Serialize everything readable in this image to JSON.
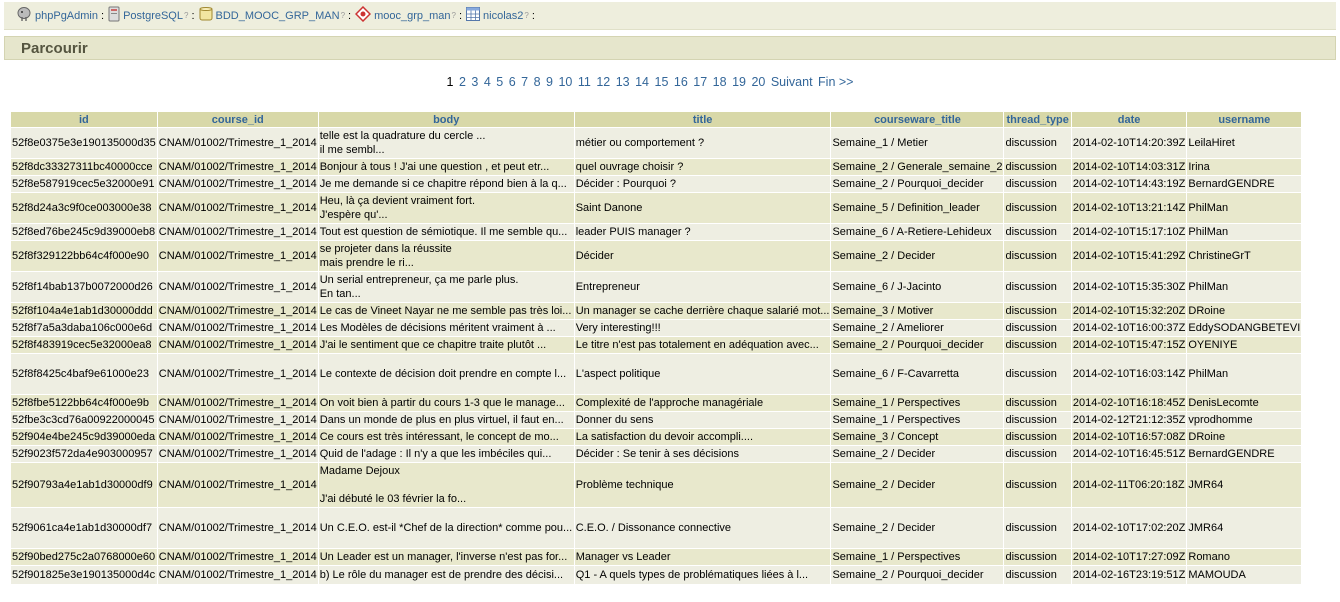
{
  "breadcrumb": {
    "server": "phpPgAdmin",
    "database_server": "PostgreSQL",
    "database": "BDD_MOOC_GRP_MAN",
    "schema": "mooc_grp_man",
    "table": "nicolas2",
    "help_mark": "?",
    "separator": ":"
  },
  "page_title": "Parcourir",
  "pager": {
    "current": "1",
    "pages": [
      "2",
      "3",
      "4",
      "5",
      "6",
      "7",
      "8",
      "9",
      "10",
      "11",
      "12",
      "13",
      "14",
      "15",
      "16",
      "17",
      "18",
      "19",
      "20"
    ],
    "next_label": "Suivant",
    "last_label": "Fin >>"
  },
  "table": {
    "columns": [
      "id",
      "course_id",
      "body",
      "title",
      "courseware_title",
      "thread_type",
      "date",
      "username"
    ],
    "rows": [
      {
        "id": "52f8e0375e3e190135000d35",
        "course_id": "CNAM/01002/Trimestre_1_2014",
        "body": "telle est la quadrature du cercle ...\nil me sembl...",
        "title": "métier ou comportement ?",
        "courseware_title": "Semaine_1 / Metier",
        "thread_type": "discussion",
        "date": "2014-02-10T14:20:39Z",
        "username": "LeilaHiret"
      },
      {
        "id": "52f8dc33327311bc40000cce",
        "course_id": "CNAM/01002/Trimestre_1_2014",
        "body": "Bonjour à tous ! J'ai une question , et peut etr...",
        "title": "quel ouvrage choisir ?",
        "courseware_title": "Semaine_2 / Generale_semaine_2",
        "thread_type": "discussion",
        "date": "2014-02-10T14:03:31Z",
        "username": "Irina"
      },
      {
        "id": "52f8e587919cec5e32000e91",
        "course_id": "CNAM/01002/Trimestre_1_2014",
        "body": "Je me demande si ce chapitre répond bien à la q...",
        "title": "Décider : Pourquoi ?",
        "courseware_title": "Semaine_2 / Pourquoi_decider",
        "thread_type": "discussion",
        "date": "2014-02-10T14:43:19Z",
        "username": "BernardGENDRE"
      },
      {
        "id": "52f8d24a3c9f0ce003000e38",
        "course_id": "CNAM/01002/Trimestre_1_2014",
        "body": "Heu, là ça devient vraiment fort.\nJ'espère qu'...",
        "title": "Saint Danone",
        "courseware_title": "Semaine_5 / Definition_leader",
        "thread_type": "discussion",
        "date": "2014-02-10T13:21:14Z",
        "username": "PhilMan"
      },
      {
        "id": "52f8ed76be245c9d39000eb8",
        "course_id": "CNAM/01002/Trimestre_1_2014",
        "body": "Tout est question de sémiotique. Il me semble qu...",
        "title": "leader PUIS manager ?",
        "courseware_title": "Semaine_6 / A-Retiere-Lehideux",
        "thread_type": "discussion",
        "date": "2014-02-10T15:17:10Z",
        "username": "PhilMan"
      },
      {
        "id": "52f8f329122bb64c4f000e90",
        "course_id": "CNAM/01002/Trimestre_1_2014",
        "body": "se projeter dans la réussite\nmais prendre le ri...",
        "title": "Décider",
        "courseware_title": "Semaine_2 / Decider",
        "thread_type": "discussion",
        "date": "2014-02-10T15:41:29Z",
        "username": "ChristineGrT"
      },
      {
        "id": "52f8f14bab137b0072000d26",
        "course_id": "CNAM/01002/Trimestre_1_2014",
        "body": "Un serial entrepreneur, ça me parle plus.\nEn tan...",
        "title": "Entrepreneur",
        "courseware_title": "Semaine_6 / J-Jacinto",
        "thread_type": "discussion",
        "date": "2014-02-10T15:35:30Z",
        "username": "PhilMan"
      },
      {
        "id": "52f8f104a4e1ab1d30000ddd",
        "course_id": "CNAM/01002/Trimestre_1_2014",
        "body": "Le cas de Vineet Nayar ne me semble pas très loi...",
        "title": "Un manager se cache derrière chaque salarié mot...",
        "courseware_title": "Semaine_3 / Motiver",
        "thread_type": "discussion",
        "date": "2014-02-10T15:32:20Z",
        "username": "DRoine"
      },
      {
        "id": "52f8f7a5a3daba106c000e6d",
        "course_id": "CNAM/01002/Trimestre_1_2014",
        "body": "Les Modèles de décisions méritent vraiment à ...",
        "title": "Very interesting!!!",
        "courseware_title": "Semaine_2 / Ameliorer",
        "thread_type": "discussion",
        "date": "2014-02-10T16:00:37Z",
        "username": "EddySODANGBETEVI"
      },
      {
        "id": "52f8f483919cec5e32000ea8",
        "course_id": "CNAM/01002/Trimestre_1_2014",
        "body": "J'ai le sentiment que ce chapitre traite plutôt ...",
        "title": "Le titre n'est pas totalement en adéquation avec...",
        "courseware_title": "Semaine_2 / Pourquoi_decider",
        "thread_type": "discussion",
        "date": "2014-02-10T15:47:15Z",
        "username": "OYENIYE"
      },
      {
        "id": "52f8f8425c4baf9e61000e23",
        "course_id": "CNAM/01002/Trimestre_1_2014",
        "body": "Le contexte de décision doit prendre en compte l...",
        "title": "L'aspect politique",
        "courseware_title": "Semaine_6 /  F-Cavarretta",
        "thread_type": "discussion",
        "date": "2014-02-10T16:03:14Z",
        "username": "PhilMan"
      },
      {
        "id": "52f8fbe5122bb64c4f000e9b",
        "course_id": "CNAM/01002/Trimestre_1_2014",
        "body": "On voit bien à partir du cours 1-3 que le manage...",
        "title": "Complexité de l'approche managériale",
        "courseware_title": "Semaine_1 / Perspectives",
        "thread_type": "discussion",
        "date": "2014-02-10T16:18:45Z",
        "username": "DenisLecomte"
      },
      {
        "id": "52fbe3c3cd76a00922000045",
        "course_id": "CNAM/01002/Trimestre_1_2014",
        "body": "Dans un monde de plus en plus virtuel, il faut en...",
        "title": "Donner du sens",
        "courseware_title": "Semaine_1 / Perspectives",
        "thread_type": "discussion",
        "date": "2014-02-12T21:12:35Z",
        "username": "vprodhomme"
      },
      {
        "id": "52f904e4be245c9d39000eda",
        "course_id": "CNAM/01002/Trimestre_1_2014",
        "body": "Ce cours est très intéressant, le concept de mo...",
        "title": "La satisfaction du devoir accompli....",
        "courseware_title": "Semaine_3 / Concept",
        "thread_type": "discussion",
        "date": "2014-02-10T16:57:08Z",
        "username": "DRoine"
      },
      {
        "id": "52f9023f572da4e903000957",
        "course_id": "CNAM/01002/Trimestre_1_2014",
        "body": "Quid de l'adage : Il n'y a que les imbéciles qui...",
        "title": "Décider : Se tenir à ses décisions",
        "courseware_title": "Semaine_2 / Decider",
        "thread_type": "discussion",
        "date": "2014-02-10T16:45:51Z",
        "username": "BernardGENDRE"
      },
      {
        "id": "52f90793a4e1ab1d30000df9",
        "course_id": "CNAM/01002/Trimestre_1_2014",
        "body": "Madame Dejoux\n\nJ'ai débuté le 03 février la fo...",
        "title": "Problème technique",
        "courseware_title": "Semaine_2 / Decider",
        "thread_type": "discussion",
        "date": "2014-02-11T06:20:18Z",
        "username": "JMR64"
      },
      {
        "id": "52f9061ca4e1ab1d30000df7",
        "course_id": "CNAM/01002/Trimestre_1_2014",
        "body": "Un C.E.O. est-il *Chef de la direction* comme pou...",
        "title": "C.E.O.  / Dissonance connective",
        "courseware_title": "Semaine_2 / Decider",
        "thread_type": "discussion",
        "date": "2014-02-10T17:02:20Z",
        "username": "JMR64"
      },
      {
        "id": "52f90bed275c2a0768000e60",
        "course_id": "CNAM/01002/Trimestre_1_2014",
        "body": "Un Leader est un manager, l'inverse n'est pas for...",
        "title": "Manager vs Leader",
        "courseware_title": "Semaine_1 / Perspectives",
        "thread_type": "discussion",
        "date": "2014-02-10T17:27:09Z",
        "username": "Romano"
      },
      {
        "id": "52f901825e3e190135000d4c",
        "course_id": "CNAM/01002/Trimestre_1_2014",
        "body": "b)    Le rôle du manager est de prendre des décisi...",
        "title": "Q1 - A quels types de problématiques liées à l...",
        "courseware_title": "Semaine_2 / Pourquoi_decider",
        "thread_type": "discussion",
        "date": "2014-02-16T23:19:51Z",
        "username": "MAMOUDA"
      }
    ]
  }
}
